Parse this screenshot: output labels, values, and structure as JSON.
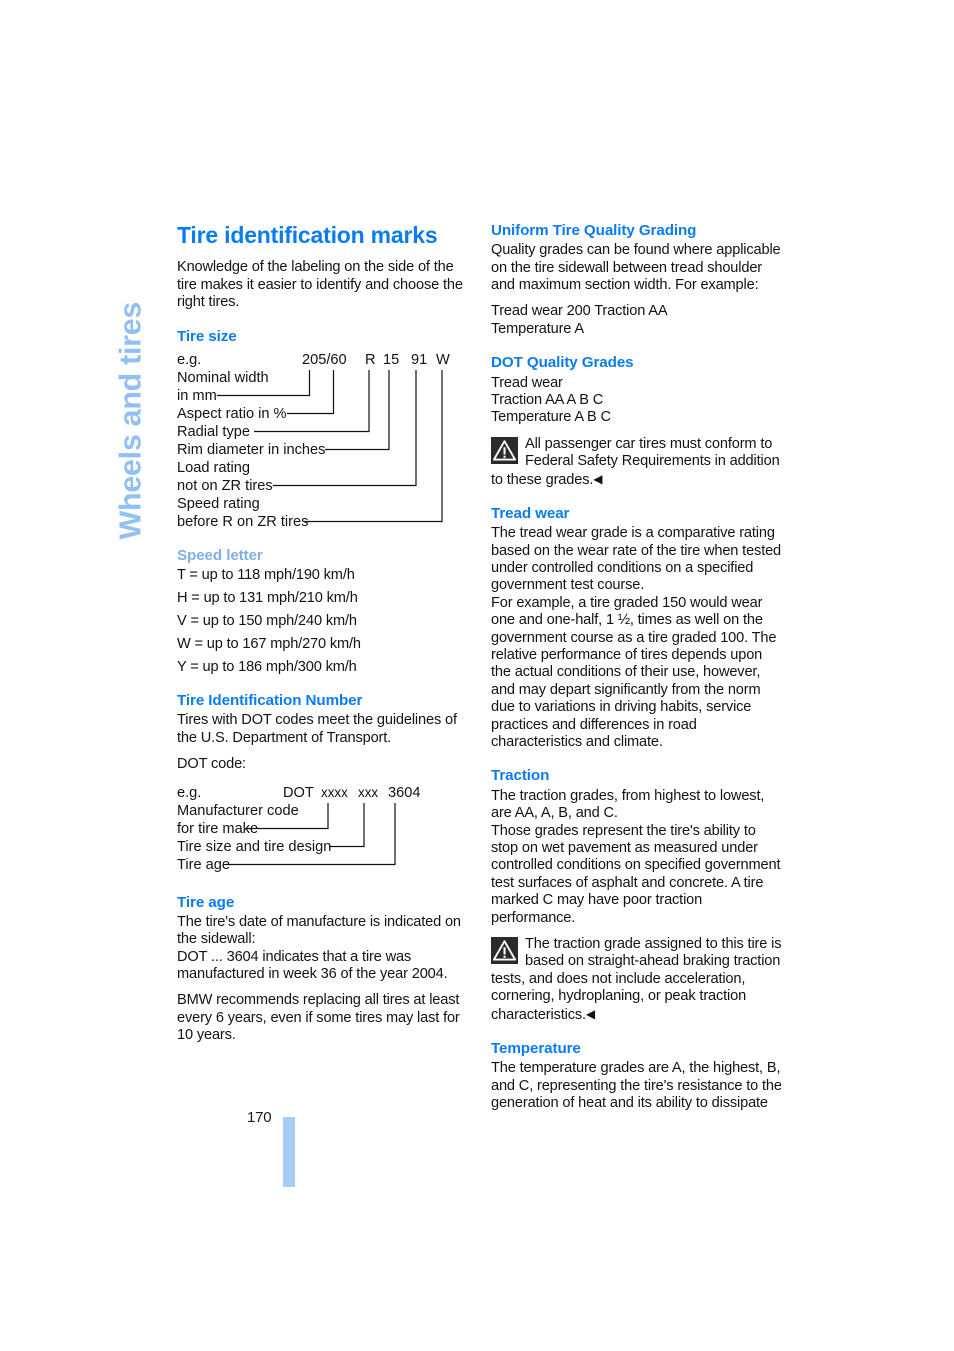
{
  "chapter": {
    "tab_label": "Wheels and tires"
  },
  "page": {
    "number": "170"
  },
  "left": {
    "title": "Tire identification marks",
    "intro": "Knowledge of the labeling on the side of the tire makes it easier to identify and choose the right tires.",
    "tire_size": {
      "heading": "Tire size",
      "example_label": "e.g.",
      "code_parts": [
        "205/60",
        "R",
        "15",
        "91",
        "W"
      ],
      "callouts": [
        "Nominal width",
        "in mm",
        "Aspect ratio in %",
        "Radial type",
        "Rim diameter in inches",
        "Load rating",
        "not on ZR tires",
        "Speed rating",
        "before R on ZR tires"
      ]
    },
    "speed_letter": {
      "heading": "Speed letter",
      "rows": [
        "T = up to 118 mph/190 km/h",
        "H = up to 131 mph/210 km/h",
        "V = up to 150 mph/240 km/h",
        "W = up to 167 mph/270 km/h",
        "Y = up to 186 mph/300 km/h"
      ]
    },
    "tin": {
      "heading": "Tire Identification Number",
      "para": "Tires with DOT codes meet the guidelines of the U.S. Department of Transport.",
      "dot_label": "DOT code:",
      "example_label": "e.g.",
      "code_parts": [
        "DOT",
        "xxxx",
        "xxx",
        "3604"
      ],
      "callouts": [
        "Manufacturer code",
        "for tire make",
        "Tire size and tire design",
        "Tire age"
      ]
    },
    "tire_age": {
      "heading": "Tire age",
      "para1": "The tire's date of manufacture is indicated on the sidewall:",
      "para2": "DOT ... 3604 indicates that a tire was manufactured in week 36 of the year 2004.",
      "para3": "BMW recommends replacing all tires at least every 6 years, even if some tires may last for 10 years."
    }
  },
  "right": {
    "utqg": {
      "heading": "Uniform Tire Quality Grading",
      "para": "Quality grades can be found where applicable on the tire sidewall between tread shoulder and maximum section width. For example:",
      "example1": "Tread wear 200 Traction AA",
      "example2": "Temperature A"
    },
    "dot_grades": {
      "heading": "DOT Quality Grades",
      "rows": [
        "Tread wear",
        "Traction AA A B C",
        "Temperature A B C"
      ],
      "note": "All passenger car tires must conform to Federal Safety Requirements in addition to these grades.",
      "note_arrow": "◀"
    },
    "tread_wear": {
      "heading": "Tread wear",
      "para1": "The tread wear grade is a comparative rating based on the wear rate of the tire when tested under controlled conditions on a specified government test course.",
      "para2": "For example, a tire graded 150 would wear one and one-half, 1 ½, times as well on the government course as a tire graded 100. The relative performance of tires depends upon the actual conditions of their use, however, and may depart significantly from the norm due to variations in driving habits, service practices and differences in road characteristics and climate."
    },
    "traction": {
      "heading": "Traction",
      "para1": "The traction grades, from highest to lowest, are AA, A, B, and C.",
      "para2": "Those grades represent the tire's ability to stop on wet pavement as measured under controlled conditions on specified government test surfaces of asphalt and concrete. A tire marked C may have poor traction performance.",
      "note": "The traction grade assigned to this tire is based on straight-ahead braking traction tests, and does not include acceleration, cornering, hydroplaning, or peak traction characteristics.",
      "note_arrow": "◀"
    },
    "temperature": {
      "heading": "Temperature",
      "para1": "The temperature grades are A, the highest, B, and C, representing the tire's resistance to the generation of heat and its ability to dissipate"
    }
  },
  "colors": {
    "heading_blue": "#0a7cf0",
    "soft_blue": "#7fb0e9",
    "tab_blue": "#91c0f4",
    "folio_bar": "#a8ccf4",
    "body_text": "#131313"
  }
}
